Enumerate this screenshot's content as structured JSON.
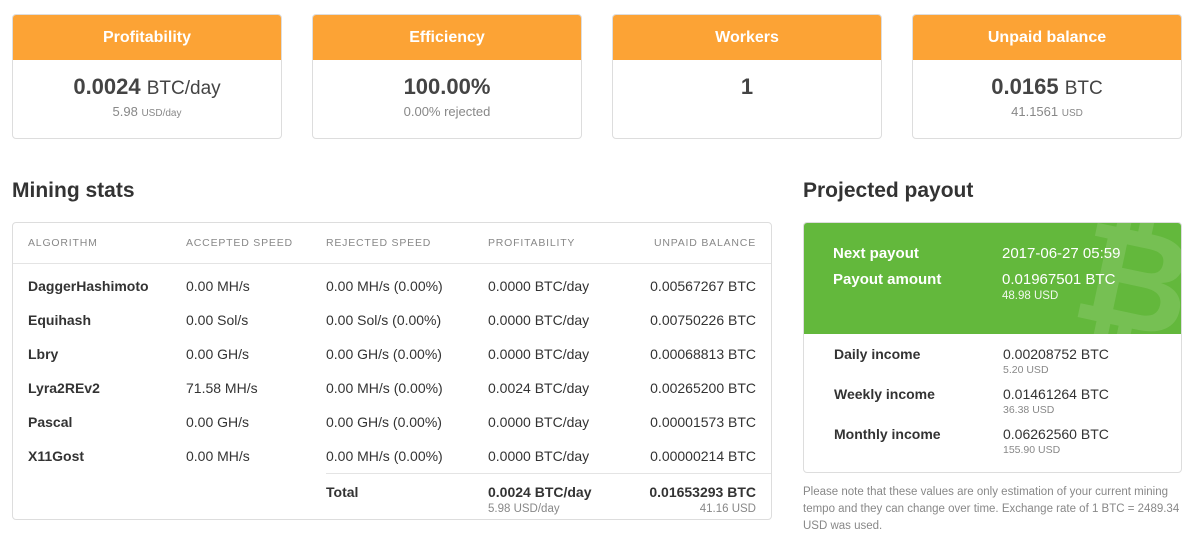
{
  "cards": [
    {
      "title": "Profitability",
      "value": "0.0024",
      "unit": "BTC/day",
      "sub_value": "5.98",
      "sub_unit": "USD/day"
    },
    {
      "title": "Efficiency",
      "value": "100.00%",
      "unit": "",
      "sub_value": "0.00% rejected",
      "sub_unit": ""
    },
    {
      "title": "Workers",
      "value": "1",
      "unit": "",
      "sub_value": "",
      "sub_unit": ""
    },
    {
      "title": "Unpaid balance",
      "value": "0.0165",
      "unit": "BTC",
      "sub_value": "41.1561",
      "sub_unit": "USD"
    }
  ],
  "mining_stats": {
    "title": "Mining stats",
    "headers": [
      "ALGORITHM",
      "ACCEPTED SPEED",
      "REJECTED SPEED",
      "PROFITABILITY",
      "UNPAID BALANCE"
    ],
    "rows": [
      {
        "algorithm": "DaggerHashimoto",
        "accepted": "0.00 MH/s",
        "rejected": "0.00 MH/s (0.00%)",
        "profitability": "0.0000 BTC/day",
        "unpaid": "0.00567267 BTC"
      },
      {
        "algorithm": "Equihash",
        "accepted": "0.00 Sol/s",
        "rejected": "0.00 Sol/s (0.00%)",
        "profitability": "0.0000 BTC/day",
        "unpaid": "0.00750226 BTC"
      },
      {
        "algorithm": "Lbry",
        "accepted": "0.00 GH/s",
        "rejected": "0.00 GH/s (0.00%)",
        "profitability": "0.0000 BTC/day",
        "unpaid": "0.00068813 BTC"
      },
      {
        "algorithm": "Lyra2REv2",
        "accepted": "71.58 MH/s",
        "rejected": "0.00 MH/s (0.00%)",
        "profitability": "0.0024 BTC/day",
        "unpaid": "0.00265200 BTC"
      },
      {
        "algorithm": "Pascal",
        "accepted": "0.00 GH/s",
        "rejected": "0.00 GH/s (0.00%)",
        "profitability": "0.0000 BTC/day",
        "unpaid": "0.00001573 BTC"
      },
      {
        "algorithm": "X11Gost",
        "accepted": "0.00 MH/s",
        "rejected": "0.00 MH/s (0.00%)",
        "profitability": "0.0000 BTC/day",
        "unpaid": "0.00000214 BTC"
      }
    ],
    "total": {
      "label": "Total",
      "profitability": "0.0024 BTC/day",
      "profitability_usd": "5.98 USD/day",
      "unpaid": "0.01653293 BTC",
      "unpaid_usd": "41.16 USD"
    }
  },
  "projected_payout": {
    "title": "Projected payout",
    "next_payout_label": "Next payout",
    "next_payout_value": "2017-06-27 05:59",
    "payout_amount_label": "Payout amount",
    "payout_amount_value": "0.01967501 BTC",
    "payout_amount_usd": "48.98 USD",
    "income": [
      {
        "label": "Daily income",
        "btc": "0.00208752 BTC",
        "usd": "5.20 USD"
      },
      {
        "label": "Weekly income",
        "btc": "0.01461264 BTC",
        "usd": "36.38 USD"
      },
      {
        "label": "Monthly income",
        "btc": "0.06262560 BTC",
        "usd": "155.90 USD"
      }
    ],
    "note": "Please note that these values are only estimation of your current mining tempo and they can change over time. Exchange rate of 1 BTC = 2489.34 USD was used."
  },
  "colors": {
    "orange": "#fca335",
    "green": "#63b83c"
  },
  "icons": {
    "watermark": "bitcoin-icon"
  }
}
